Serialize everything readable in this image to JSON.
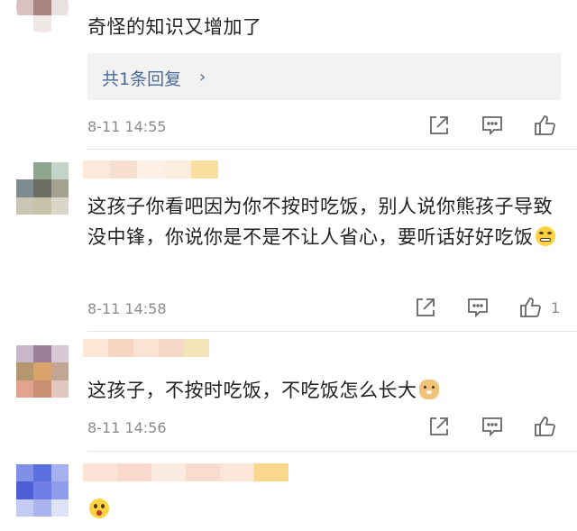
{
  "comments": [
    {
      "text": "奇怪的知识又增加了",
      "reply_label": "共1条回复",
      "reply_arrow": "›",
      "time": "8-11 14:55",
      "likes": ""
    },
    {
      "text": "这孩子你看吧因为你不按时吃饭，别人说你熊孩子导致没中锋，你说你是不是不让人省心，要听话好好吃饭",
      "time": "8-11 14:58",
      "likes": "1",
      "emoji": "grimace-emoji"
    },
    {
      "text": "这孩子，不按时吃饭，不吃饭怎么长大",
      "time": "8-11 14:56",
      "likes": "",
      "emoji": "doge-emoji"
    },
    {
      "text": "",
      "emoji": "surprised-emoji"
    }
  ],
  "icons": {
    "share": "share-icon",
    "comment": "comment-icon",
    "like": "thumbs-up-icon"
  },
  "colors": {
    "reply_link": "#4a6a9a",
    "meta_text": "#8a8a8a",
    "reply_bg": "#f2f2f2"
  }
}
